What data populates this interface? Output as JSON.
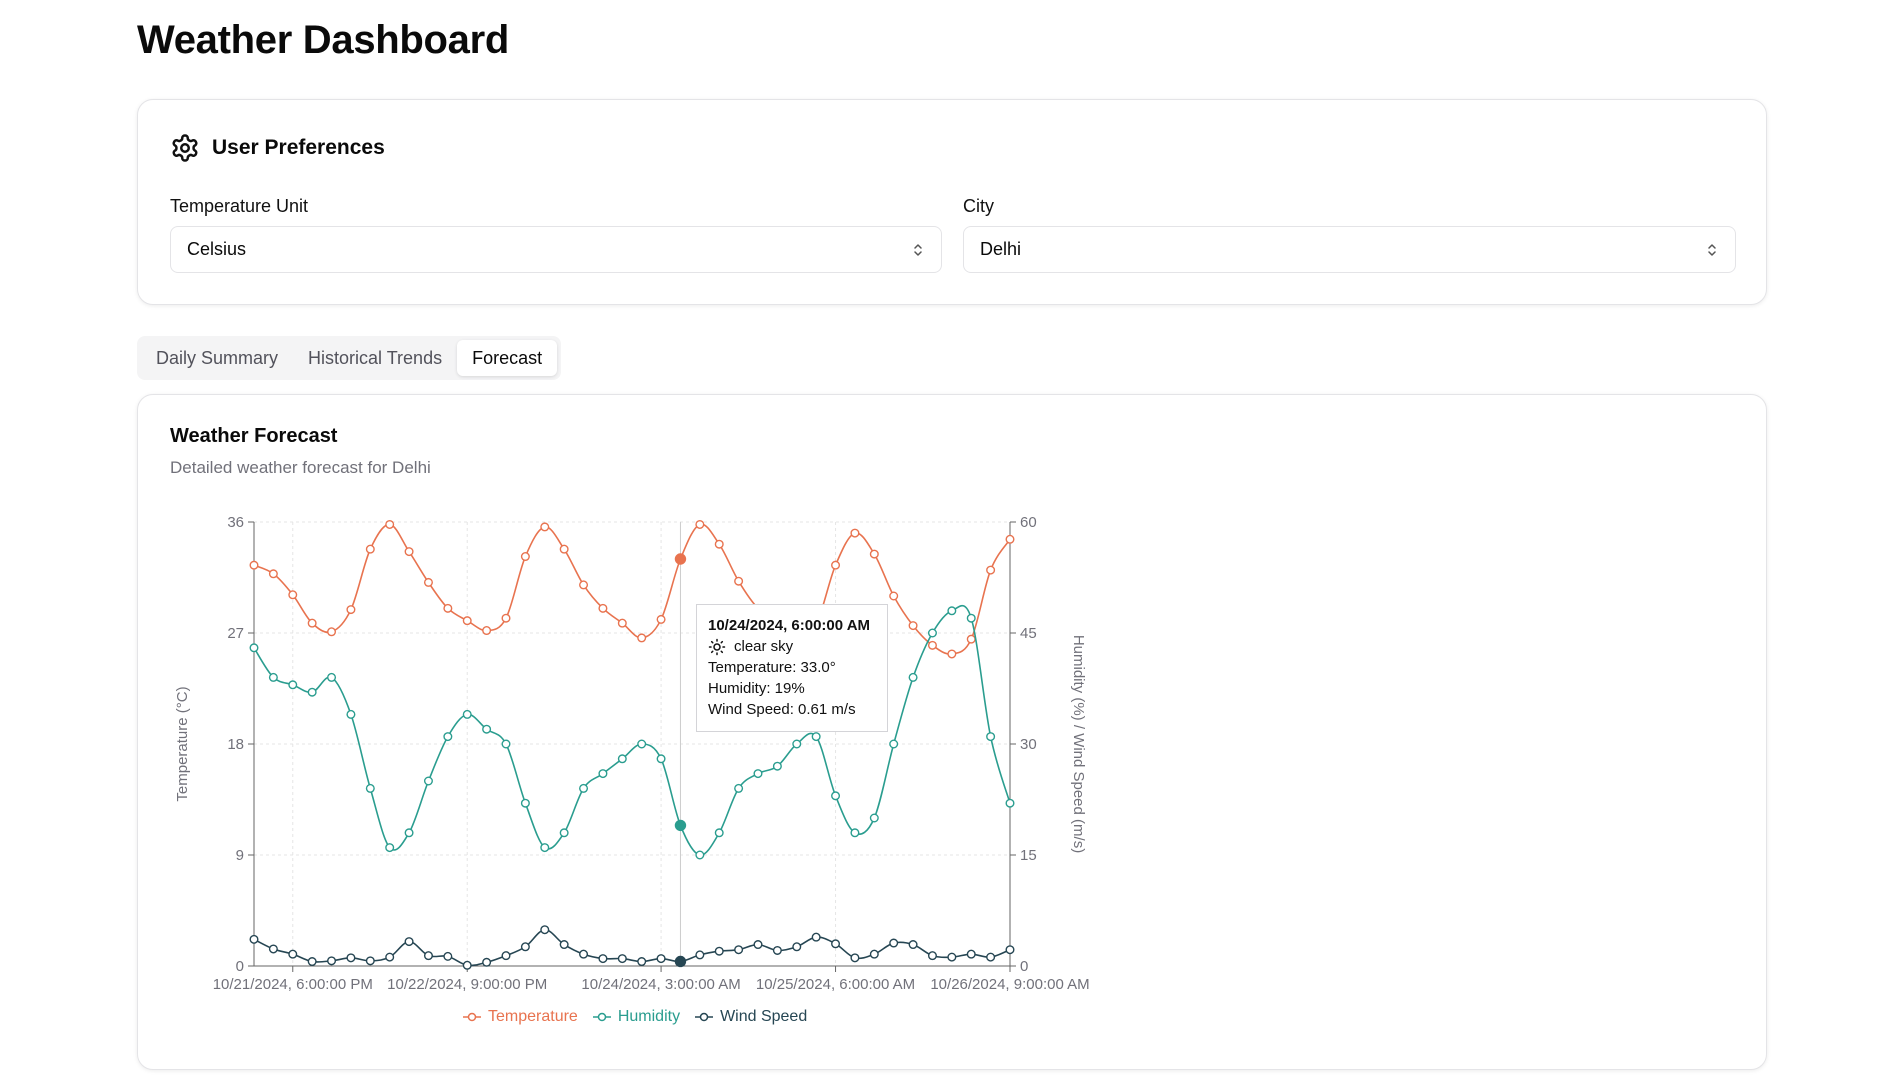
{
  "page_title": "Weather Dashboard",
  "preferences": {
    "title": "User Preferences",
    "temperature_unit_label": "Temperature Unit",
    "temperature_unit_value": "Celsius",
    "city_label": "City",
    "city_value": "Delhi"
  },
  "tabs": [
    {
      "label": "Daily Summary",
      "active": false
    },
    {
      "label": "Historical Trends",
      "active": false
    },
    {
      "label": "Forecast",
      "active": true
    }
  ],
  "forecast": {
    "title": "Weather Forecast",
    "subtitle": "Detailed weather forecast for Delhi"
  },
  "colors": {
    "temperature": "#e8734f",
    "humidity": "#2a9d8f",
    "wind": "#264653"
  },
  "tooltip": {
    "title": "10/24/2024, 6:00:00 AM",
    "condition": "clear sky",
    "icon": "sun-icon",
    "temperature": "Temperature: 33.0°",
    "humidity": "Humidity: 19%",
    "wind": "Wind Speed: 0.61 m/s"
  },
  "chart_data": {
    "type": "line",
    "x": [
      "10/21/2024, 3:00:00 PM",
      "10/21/2024, 6:00:00 PM",
      "10/21/2024, 9:00:00 PM",
      "10/22/2024, 12:00:00 AM",
      "10/22/2024, 3:00:00 AM",
      "10/22/2024, 6:00:00 AM",
      "10/22/2024, 9:00:00 AM",
      "10/22/2024, 12:00:00 PM",
      "10/22/2024, 3:00:00 PM",
      "10/22/2024, 6:00:00 PM",
      "10/22/2024, 9:00:00 PM",
      "10/23/2024, 12:00:00 AM",
      "10/23/2024, 3:00:00 AM",
      "10/23/2024, 6:00:00 AM",
      "10/23/2024, 9:00:00 AM",
      "10/23/2024, 12:00:00 PM",
      "10/23/2024, 3:00:00 PM",
      "10/23/2024, 6:00:00 PM",
      "10/23/2024, 9:00:00 PM",
      "10/24/2024, 12:00:00 AM",
      "10/24/2024, 3:00:00 AM",
      "10/24/2024, 6:00:00 AM",
      "10/24/2024, 9:00:00 AM",
      "10/24/2024, 12:00:00 PM",
      "10/24/2024, 3:00:00 PM",
      "10/24/2024, 6:00:00 PM",
      "10/24/2024, 9:00:00 PM",
      "10/25/2024, 12:00:00 AM",
      "10/25/2024, 3:00:00 AM",
      "10/25/2024, 6:00:00 AM",
      "10/25/2024, 9:00:00 AM",
      "10/25/2024, 12:00:00 PM",
      "10/25/2024, 3:00:00 PM",
      "10/25/2024, 6:00:00 PM",
      "10/25/2024, 9:00:00 PM",
      "10/26/2024, 12:00:00 AM",
      "10/26/2024, 3:00:00 AM",
      "10/26/2024, 6:00:00 AM",
      "10/26/2024, 9:00:00 AM",
      "10/26/2024, 12:00:00 PM"
    ],
    "x_tick_labels": [
      "10/21/2024, 6:00:00 PM",
      "10/22/2024, 9:00:00 PM",
      "10/24/2024, 3:00:00 AM",
      "10/25/2024, 6:00:00 AM",
      "10/26/2024, 9:00:00 AM"
    ],
    "x_tick_indices": [
      2,
      11,
      21,
      30,
      39
    ],
    "series": [
      {
        "name": "Temperature",
        "axis": "left",
        "values": [
          32.5,
          31.8,
          30.1,
          27.8,
          27.1,
          28.9,
          33.8,
          35.8,
          33.6,
          31.1,
          29.0,
          28.0,
          27.2,
          28.2,
          33.2,
          35.6,
          33.8,
          30.9,
          29.0,
          27.8,
          26.6,
          28.1,
          33.0,
          35.8,
          34.2,
          31.2,
          29.0,
          28.0,
          27.5,
          27.8,
          32.5,
          35.1,
          33.4,
          30.0,
          27.6,
          26.0,
          25.3,
          26.5,
          32.1,
          34.6
        ]
      },
      {
        "name": "Humidity",
        "axis": "right",
        "values": [
          43,
          39,
          38,
          37,
          39,
          34,
          24,
          16,
          18,
          25,
          31,
          34,
          32,
          30,
          22,
          16,
          18,
          24,
          26,
          28,
          30,
          28,
          19,
          15,
          18,
          24,
          26,
          27,
          30,
          31,
          23,
          18,
          20,
          30,
          39,
          45,
          48,
          47,
          31,
          22
        ]
      },
      {
        "name": "Wind Speed",
        "axis": "right",
        "values": [
          3.6,
          2.3,
          1.6,
          0.6,
          0.7,
          1.1,
          0.7,
          1.2,
          3.3,
          1.4,
          1.3,
          0.1,
          0.5,
          1.4,
          2.6,
          4.9,
          2.9,
          1.6,
          1.0,
          1.0,
          0.6,
          1.0,
          0.61,
          1.5,
          2.0,
          2.2,
          2.9,
          2.1,
          2.6,
          3.9,
          3.0,
          1.1,
          1.6,
          3.1,
          2.9,
          1.4,
          1.2,
          1.6,
          1.2,
          2.2
        ]
      }
    ],
    "highlight_index": 22,
    "ylabel_left": "Temperature (°C)",
    "ylabel_right": "Humidity (%) / Wind Speed (m/s)",
    "ylim_left": [
      0,
      36
    ],
    "ylim_right": [
      0,
      60
    ],
    "yticks_left": [
      "0",
      "9",
      "18",
      "27",
      "36"
    ],
    "yticks_right": [
      "0",
      "15",
      "30",
      "45",
      "60"
    ],
    "grid": true,
    "legend": "bottom-center"
  }
}
